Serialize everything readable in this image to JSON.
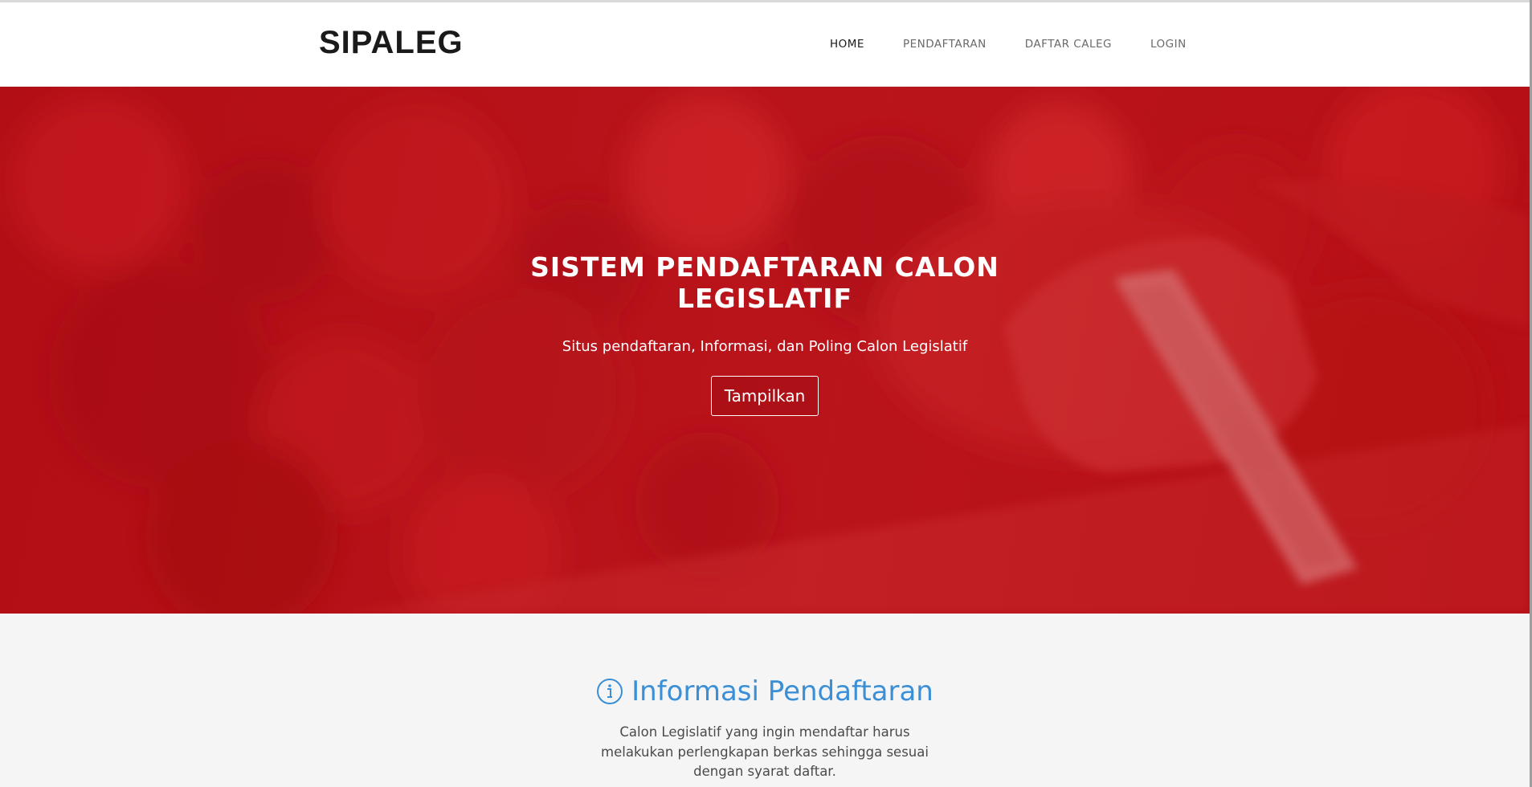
{
  "brand": {
    "name": "SIPALEG"
  },
  "nav": {
    "items": [
      {
        "label": "HOME",
        "active": true
      },
      {
        "label": "PENDAFTARAN",
        "active": false
      },
      {
        "label": "DAFTAR CALEG",
        "active": false
      },
      {
        "label": "LOGIN",
        "active": false
      }
    ]
  },
  "hero": {
    "title": "SISTEM PENDAFTARAN CALON LEGISLATIF",
    "subtitle": "Situs pendaftaran, Informasi, dan Poling Calon Legislatif",
    "button_label": "Tampilkan",
    "accent_color": "#c8141b"
  },
  "info": {
    "icon": "info-circle-icon",
    "heading": "Informasi Pendaftaran",
    "heading_color": "#3a8fd6",
    "text": "Calon Legislatif yang ingin mendaftar harus melakukan perlengkapan berkas sehingga sesuai dengan syarat daftar."
  }
}
